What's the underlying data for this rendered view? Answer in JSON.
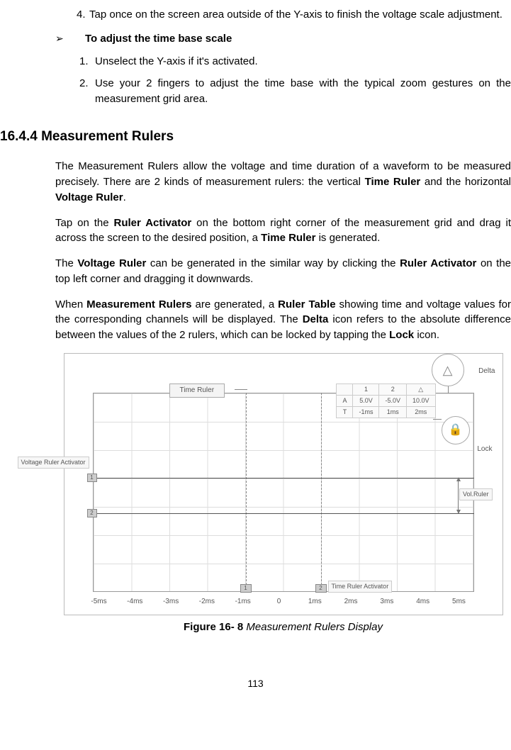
{
  "list1": {
    "item4_num": "4.",
    "item4_text": "Tap once on the screen area outside of the Y-axis to finish the voltage scale adjustment."
  },
  "subheading": {
    "arrow": "➢",
    "text": "To adjust the time base scale"
  },
  "list2": {
    "item1_num": "1.",
    "item1_text": "Unselect the Y-axis if it's activated.",
    "item2_num": "2.",
    "item2_text": "Use your 2 fingers to adjust the time base with the typical zoom gestures on the measurement grid area."
  },
  "heading": "16.4.4 Measurement Rulers",
  "paragraphs": {
    "p1_a": "The Measurement Rulers allow the voltage and time duration of a waveform to be measured precisely. There are 2 kinds of measurement rulers: the vertical ",
    "p1_b": "Time Ruler",
    "p1_c": " and the horizontal ",
    "p1_d": "Voltage Ruler",
    "p1_e": ".",
    "p2_a": "Tap on the ",
    "p2_b": "Ruler Activator",
    "p2_c": " on the bottom right corner of the measurement grid and drag it across the screen to the desired position, a ",
    "p2_d": "Time Ruler",
    "p2_e": " is generated.",
    "p3_a": "The ",
    "p3_b": "Voltage Ruler",
    "p3_c": " can be generated in the similar way by clicking the ",
    "p3_d": "Ruler Activator",
    "p3_e": " on the top left corner and dragging it downwards.",
    "p4_a": "When ",
    "p4_b": "Measurement Rulers",
    "p4_c": " are generated, a ",
    "p4_d": "Ruler Table",
    "p4_e": " showing time and voltage values for the corresponding channels will be displayed. The ",
    "p4_f": "Delta",
    "p4_g": " icon refers to the absolute difference between the values of the 2 rulers, which can be locked by tapping the ",
    "p4_h": "Lock",
    "p4_i": " icon."
  },
  "figure": {
    "time_ruler_label": "Time Ruler",
    "volt_act_label": "Voltage Ruler Activator",
    "vol_ruler_label": "Vol.Ruler",
    "time_ruler_act_label": "Time Ruler Activator",
    "delta_glyph": "△",
    "delta_label": "Delta",
    "lock_glyph": "🔒",
    "lock_label": "Lock",
    "table": {
      "h1": "1",
      "h2": "2",
      "hd": "△",
      "rA": "A",
      "rA1": "5.0V",
      "rA2": "-5.0V",
      "rAd": "10.0V",
      "rT": "T",
      "rT1": "-1ms",
      "rT2": "1ms",
      "rTd": "2ms"
    },
    "xaxis": [
      "-5ms",
      "-4ms",
      "-3ms",
      "-2ms",
      "-1ms",
      "0",
      "1ms",
      "2ms",
      "3ms",
      "4ms",
      "5ms"
    ],
    "handle1": "1",
    "handle2": "2"
  },
  "caption": {
    "bold": "Figure 16- 8",
    "italic": " Measurement Rulers Display"
  },
  "page_number": "113"
}
